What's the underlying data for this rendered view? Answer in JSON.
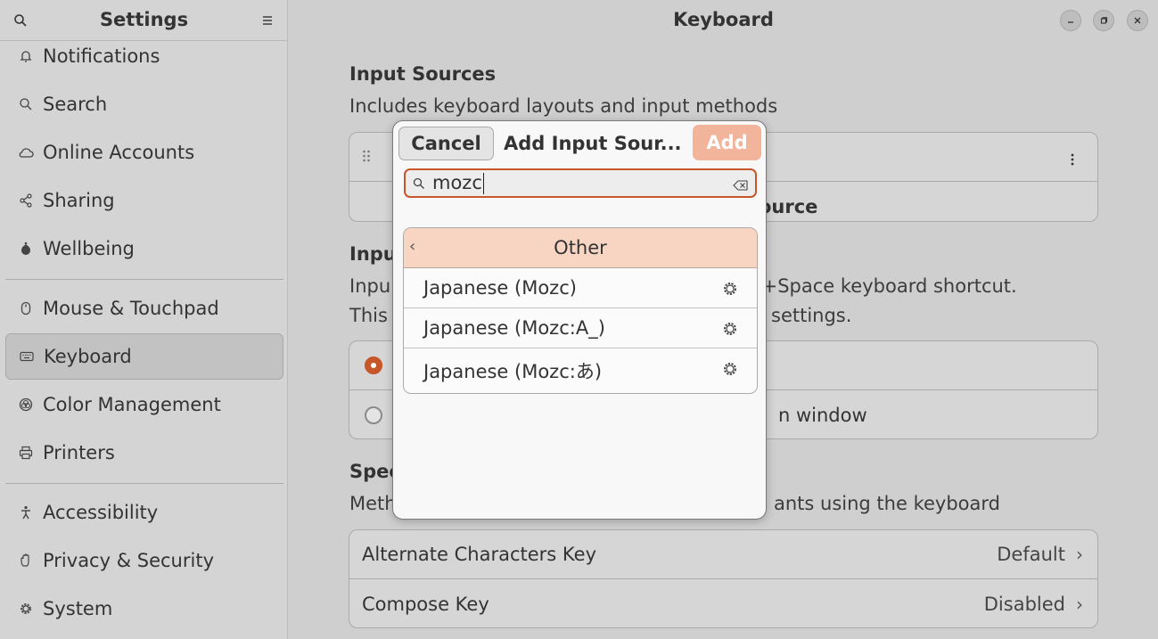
{
  "sidebar": {
    "title": "Settings",
    "items": [
      {
        "label": "Notifications"
      },
      {
        "label": "Search"
      },
      {
        "label": "Online Accounts"
      },
      {
        "label": "Sharing"
      },
      {
        "label": "Wellbeing"
      },
      {
        "label": "Mouse & Touchpad"
      },
      {
        "label": "Keyboard"
      },
      {
        "label": "Color Management"
      },
      {
        "label": "Printers"
      },
      {
        "label": "Accessibility"
      },
      {
        "label": "Privacy & Security"
      },
      {
        "label": "System"
      }
    ]
  },
  "main": {
    "title": "Keyboard",
    "input_sources": {
      "heading": "Input Sources",
      "description": "Includes keyboard layouts and input methods",
      "add_row_partial": "ource"
    },
    "switching": {
      "heading_partial": "Inpu",
      "line1_left": "Inpu",
      "line1_right": "r+Space keyboard shortcut.",
      "line2_left": "This",
      "line2_right": "settings.",
      "option2_partial": "n window"
    },
    "special": {
      "heading_partial": "Spec",
      "desc_left": "Meth",
      "desc_right": "ants using the keyboard",
      "rows": [
        {
          "label": "Alternate Characters Key",
          "value": "Default"
        },
        {
          "label": "Compose Key",
          "value": "Disabled"
        }
      ]
    }
  },
  "dialog": {
    "cancel_label": "Cancel",
    "title": "Add Input Sour...",
    "add_label": "Add",
    "search_value": "mozc",
    "category": "Other",
    "results": [
      {
        "label": "Japanese (Mozc)"
      },
      {
        "label": "Japanese (Mozc:A_)"
      },
      {
        "label": "Japanese (Mozc:あ)"
      }
    ]
  },
  "colors": {
    "accent": "#c7562a",
    "accent_light": "#f2b49a",
    "category_bg": "#f7d5c2"
  }
}
